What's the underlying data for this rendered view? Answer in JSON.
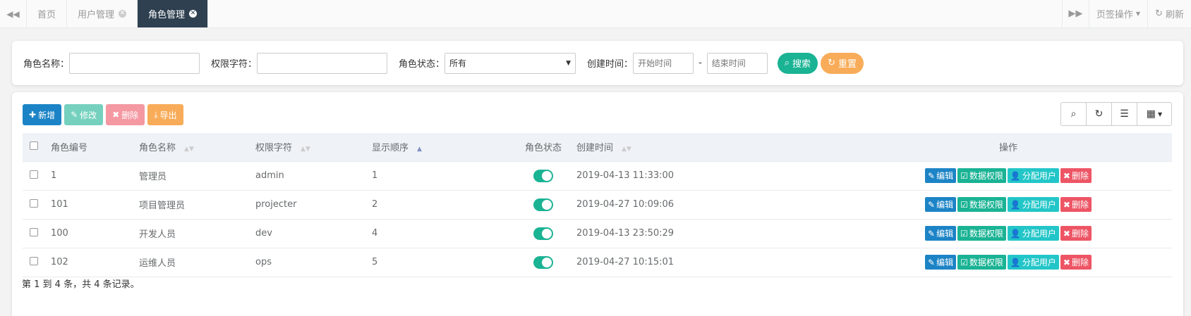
{
  "tabbar": {
    "prev_icon": "backward-icon",
    "tabs": [
      {
        "label": "首页",
        "closable": false,
        "active": false
      },
      {
        "label": "用户管理",
        "closable": true,
        "active": false
      },
      {
        "label": "角色管理",
        "closable": true,
        "active": true
      }
    ],
    "next_icon": "forward-icon",
    "tab_ops_label": "页签操作",
    "refresh_label": "刷新"
  },
  "search": {
    "role_name_label": "角色名称：",
    "role_name_value": "",
    "perm_label": "权限字符：",
    "perm_value": "",
    "status_label": "角色状态：",
    "status_selected": "所有",
    "created_label": "创建时间：",
    "start_placeholder": "开始时间",
    "end_placeholder": "结束时间",
    "dash": "-",
    "search_button": "搜索",
    "reset_button": "重置"
  },
  "toolbar": {
    "add": "新增",
    "edit": "修改",
    "delete": "删除",
    "export": "导出"
  },
  "table": {
    "columns": [
      "角色编号",
      "角色名称",
      "权限字符",
      "显示顺序",
      "角色状态",
      "创建时间",
      "操作"
    ],
    "rows": [
      {
        "id": "1",
        "name": "管理员",
        "key": "admin",
        "order": "1",
        "enabled": true,
        "created": "2019-04-13 11:33:00"
      },
      {
        "id": "101",
        "name": "项目管理员",
        "key": "projecter",
        "order": "2",
        "enabled": true,
        "created": "2019-04-27 10:09:06"
      },
      {
        "id": "100",
        "name": "开发人员",
        "key": "dev",
        "order": "4",
        "enabled": true,
        "created": "2019-04-13 23:50:29"
      },
      {
        "id": "102",
        "name": "运维人员",
        "key": "ops",
        "order": "5",
        "enabled": true,
        "created": "2019-04-27 10:15:01"
      }
    ],
    "row_actions": {
      "edit": "编辑",
      "data_perm": "数据权限",
      "assign_user": "分配用户",
      "delete": "删除"
    }
  },
  "footer": {
    "summary": "第 1 到 4 条，共 4 条记录。"
  },
  "colors": {
    "primary": "#1c84c6",
    "success": "#1ab394",
    "info": "#23c6c8",
    "danger": "#ed5565",
    "warning": "#f8ac59",
    "dark_tab": "#2f4050"
  }
}
